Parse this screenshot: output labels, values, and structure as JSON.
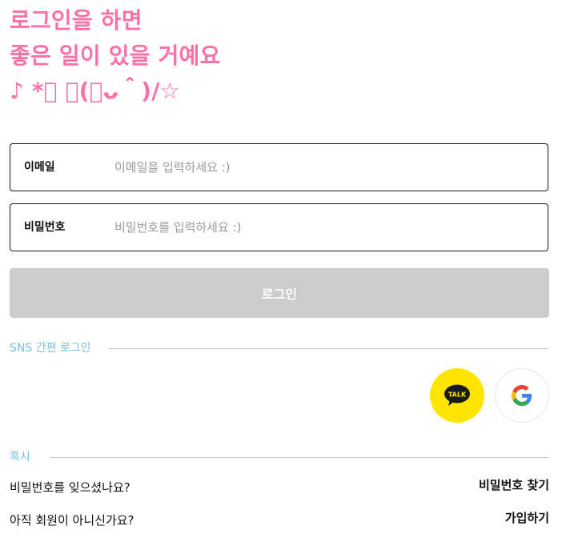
{
  "headline": {
    "line1": "로그인을 하면",
    "line2": "좋은 일이 있을 거예요",
    "line3": "♪ *ﾟ ＼(＾ᴗ＾)/☆"
  },
  "form": {
    "email_label": "이메일",
    "email_placeholder": "이메일을 입력하세요 :)",
    "email_value": "",
    "password_label": "비밀번호",
    "password_placeholder": "비밀번호를 입력하세요 :)",
    "password_value": "",
    "login_button": "로그인"
  },
  "sns": {
    "label": "SNS 간편 로그인",
    "kakao_text": "TALK",
    "kakao_color": "#FEE500",
    "buttons": [
      "kakao-talk-icon",
      "google-icon"
    ]
  },
  "help": {
    "label": "혹시",
    "forgot_question": "비밀번호를 잊으셨나요?",
    "forgot_link": "비밀번호 찾기",
    "signup_question": "아직 회원이 아니신가요?",
    "signup_link": "가입하기"
  },
  "colors": {
    "headline": "#FF6FA8",
    "section_label": "#7CC0E6",
    "login_button_bg": "#CCCCCC"
  }
}
